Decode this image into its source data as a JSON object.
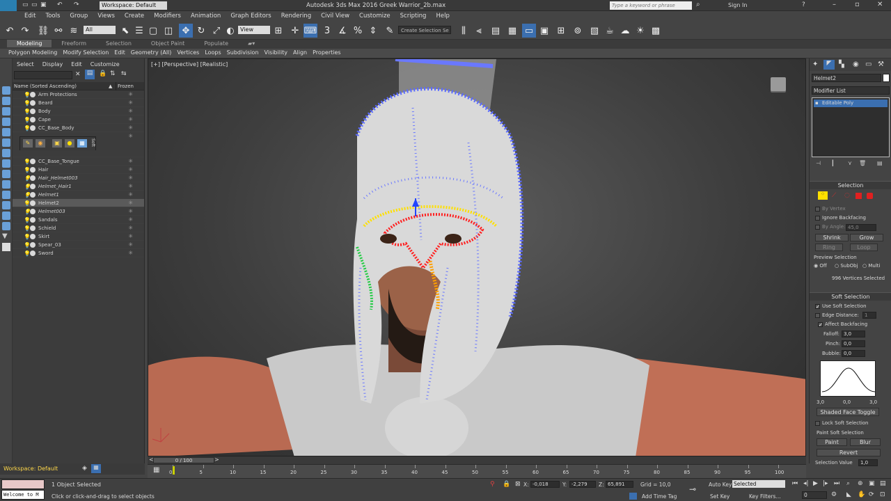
{
  "titlebar": {
    "workspace": "Workspace: Default",
    "title": "Autodesk 3ds Max 2016    Greek Warrior_2b.max",
    "search_placeholder": "Type a keyword or phrase",
    "signin": "Sign In",
    "app_logo": "MAX"
  },
  "menu": [
    "Edit",
    "Tools",
    "Group",
    "Views",
    "Create",
    "Modifiers",
    "Animation",
    "Graph Editors",
    "Rendering",
    "Civil View",
    "Customize",
    "Scripting",
    "Help"
  ],
  "toolbar": {
    "filter": "All",
    "view": "View",
    "selection_set": "Create Selection Se"
  },
  "ribbon_tabs": [
    "Modeling",
    "Freeform",
    "Selection",
    "Object Paint",
    "Populate"
  ],
  "ribbon_items": [
    "Polygon Modeling",
    "Modify Selection",
    "Edit",
    "Geometry (All)",
    "Vertices",
    "Loops",
    "Subdivision",
    "Visibility",
    "Align",
    "Properties"
  ],
  "scene": {
    "menus": [
      "Select",
      "Display",
      "Edit",
      "Customize"
    ],
    "col_name": "Name (Sorted Ascending)",
    "col_frozen": "Frozen",
    "objects": [
      "Arm Protections",
      "Beard",
      "Body",
      "Cape",
      "CC_Base_Body",
      "CC_Base_Tongue",
      "Hair",
      "Hair_Helmet003",
      "Helmet_Hair1",
      "Helmet1",
      "Helmet2",
      "Helmet003",
      "Sandals",
      "Schield",
      "Skirt",
      "Spear_03",
      "Sword"
    ],
    "soft_label": "Soft",
    "workspace_footer": "Workspace: Default"
  },
  "viewport": {
    "label": "[+] [Perspective] [Realistic]"
  },
  "command": {
    "object_name": "Helmet2",
    "modifier_list": "Modifier List",
    "stack_item": "Editable Poly",
    "selection": {
      "header": "Selection",
      "by_vertex": "By Vertex",
      "ignore_backfacing": "Ignore Backfacing",
      "by_angle": "By Angle:",
      "angle_value": "45,0",
      "shrink": "Shrink",
      "grow": "Grow",
      "ring": "Ring",
      "loop": "Loop",
      "preview": "Preview Selection",
      "off": "Off",
      "subobj": "SubObj",
      "multi": "Multi",
      "status": "996 Vertices Selected"
    },
    "soft": {
      "header": "Soft Selection",
      "use_soft": "Use Soft Selection",
      "edge_distance": "Edge Distance:",
      "edge_value": "1",
      "affect_backfacing": "Affect Backfacing",
      "falloff": "Falloff:",
      "falloff_value": "3,0",
      "pinch": "Pinch:",
      "pinch_value": "0,0",
      "bubble": "Bubble:",
      "bubble_value": "0,0",
      "curve_left": "3,0",
      "curve_mid": "0,0",
      "curve_right": "3,0",
      "shaded_toggle": "Shaded Face Toggle",
      "lock_soft": "Lock Soft Selection",
      "paint_soft": "Paint Soft Selection",
      "paint": "Paint",
      "blur": "Blur",
      "revert": "Revert",
      "sel_value_label": "Selection Value",
      "sel_value": "1,0"
    }
  },
  "timeline": {
    "frame": "0 / 100",
    "ticks": [
      "0",
      "5",
      "10",
      "15",
      "20",
      "25",
      "30",
      "35",
      "40",
      "45",
      "50",
      "55",
      "60",
      "65",
      "70",
      "75",
      "80",
      "85",
      "90",
      "95",
      "100"
    ]
  },
  "status": {
    "maxscript": "Welcome to M",
    "selected": "1 Object Selected",
    "prompt": "Click or click-and-drag to select objects",
    "x_label": "X:",
    "x": "-0,018",
    "y_label": "Y:",
    "y": "-2,279",
    "z_label": "Z:",
    "z": "65,891",
    "grid": "Grid = 10,0",
    "add_time_tag": "Add Time Tag",
    "auto_key": "Auto Key",
    "set_key": "Set Key",
    "key_mode": "Selected",
    "key_filters": "Key Filters...",
    "frame_field": "0"
  }
}
